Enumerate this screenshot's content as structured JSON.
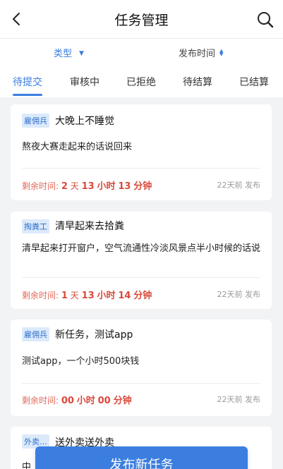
{
  "header": {
    "title": "任务管理",
    "back_icon": "chevron-left-icon",
    "search_icon": "search-icon"
  },
  "filters": {
    "type_label": "类型",
    "time_label": "发布时间"
  },
  "tabs": [
    {
      "label": "待提交",
      "active": true
    },
    {
      "label": "审核中",
      "active": false
    },
    {
      "label": "已拒绝",
      "active": false
    },
    {
      "label": "待结算",
      "active": false
    },
    {
      "label": "已结算",
      "active": false
    }
  ],
  "colors": {
    "accent": "#3b7ee0",
    "remain": "#d9493a"
  },
  "tasks": [
    {
      "badge": "雇佣兵",
      "title": "大晚上不睡觉",
      "desc": "熬夜大赛走起来的话说回来",
      "remain_label": "剩余时间:",
      "days": "2",
      "day_unit": "天",
      "hours": "13",
      "hour_unit": "小时",
      "minutes": "13",
      "minute_unit": "分钟",
      "posted": "22天前 发布"
    },
    {
      "badge": "掏粪工",
      "title": "清早起来去拾粪",
      "desc": "清早起来打开窗户，空气流通性冷淡风景点半小时候的话说",
      "remain_label": "剩余时间:",
      "days": "1",
      "day_unit": "天",
      "hours": "13",
      "hour_unit": "小时",
      "minutes": "14",
      "minute_unit": "分钟",
      "posted": "22天前 发布"
    },
    {
      "badge": "雇佣兵",
      "title": "新任务，测试app",
      "desc": "测试app，一个小时500块钱",
      "remain_label": "剩余时间:",
      "hours": "00",
      "hour_unit": "小时",
      "minutes": "00",
      "minute_unit": "分钟",
      "posted": "22天前 发布"
    },
    {
      "badge": "外卖...",
      "title": "送外卖送外卖",
      "desc": "中"
    }
  ],
  "publish_button": "发布新任务"
}
